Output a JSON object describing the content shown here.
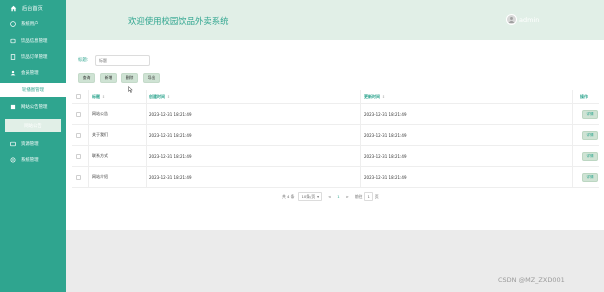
{
  "sidebar": {
    "home_label": "后台首页",
    "items": [
      {
        "label": "系统用户",
        "icon": "user-icon"
      },
      {
        "label": "饮品信息管理",
        "icon": "cup-icon"
      },
      {
        "label": "饮品订单管理",
        "icon": "order-icon"
      },
      {
        "label": "会员管理",
        "icon": "member-icon"
      },
      {
        "label": "轮播图管理",
        "icon": ""
      },
      {
        "label": "网站公告管理",
        "icon": "notice-icon"
      },
      {
        "label": "网站公告",
        "icon": ""
      },
      {
        "label": "资源管理",
        "icon": "resource-icon"
      },
      {
        "label": "系统管理",
        "icon": "system-icon"
      }
    ]
  },
  "header": {
    "title": "欢迎使用校园饮品外卖系统",
    "username": "admin"
  },
  "search": {
    "label": "标题:",
    "placeholder": "标题"
  },
  "toolbar": {
    "query": "查询",
    "add": "新增",
    "delete": "删除",
    "export": "导出"
  },
  "table": {
    "headers": {
      "title": "标题",
      "created": "创建时间",
      "updated": "更新时间",
      "actions": "操作"
    },
    "rows": [
      {
        "title": "网站公告",
        "created": "2023-12-31 18:21:49",
        "updated": "2023-12-31 18:21:49",
        "action": "详情"
      },
      {
        "title": "关于我们",
        "created": "2023-12-31 18:21:49",
        "updated": "2023-12-31 18:21:49",
        "action": "详情"
      },
      {
        "title": "联系方式",
        "created": "2023-12-31 18:21:49",
        "updated": "2023-12-31 18:21:49",
        "action": "详情"
      },
      {
        "title": "网站介绍",
        "created": "2023-12-31 18:21:49",
        "updated": "2023-12-31 18:21:49",
        "action": "详情"
      }
    ]
  },
  "pagination": {
    "total": "共 4 条",
    "page_size": "10条/页",
    "prev": "<",
    "current": "1",
    "next": ">",
    "goto_label": "前往",
    "goto_value": "1",
    "page_suffix": "页"
  },
  "watermark": "CSDN @MZ_ZXD001",
  "colors": {
    "accent": "#2fa58f",
    "header_bg": "#e1efe7",
    "button_bg": "#cfe3d4"
  }
}
